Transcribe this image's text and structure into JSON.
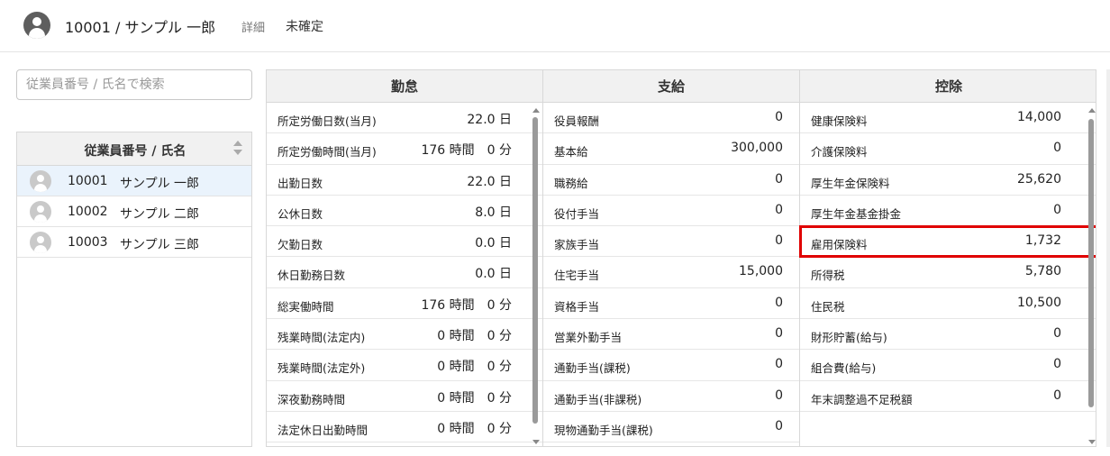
{
  "header": {
    "title": "10001 / サンプル 一郎",
    "detail_link": "詳細",
    "status": "未確定"
  },
  "search": {
    "placeholder": "従業員番号 / 氏名で検索"
  },
  "employee_list": {
    "header": "従業員番号 / 氏名",
    "items": [
      {
        "id": "10001",
        "name": "サンプル 一郎",
        "selected": true
      },
      {
        "id": "10002",
        "name": "サンプル 二郎",
        "selected": false
      },
      {
        "id": "10003",
        "name": "サンプル 三郎",
        "selected": false
      }
    ]
  },
  "kintai": {
    "header": "勤怠",
    "rows": [
      {
        "label": "所定労働日数(当月)",
        "value": "22.0 日"
      },
      {
        "label": "所定労働時間(当月)",
        "value": "176 時間　0 分"
      },
      {
        "label": "出勤日数",
        "value": "22.0 日"
      },
      {
        "label": "公休日数",
        "value": "8.0 日"
      },
      {
        "label": "欠勤日数",
        "value": "0.0 日"
      },
      {
        "label": "休日勤務日数",
        "value": "0.0 日"
      },
      {
        "label": "総実働時間",
        "value": "176 時間　0 分"
      },
      {
        "label": "残業時間(法定内)",
        "value": "0 時間　0 分"
      },
      {
        "label": "残業時間(法定外)",
        "value": "0 時間　0 分"
      },
      {
        "label": "深夜勤務時間",
        "value": "0 時間　0 分"
      },
      {
        "label": "法定休日出勤時間",
        "value": "0 時間　0 分"
      }
    ]
  },
  "shikyu": {
    "header": "支給",
    "rows": [
      {
        "label": "役員報酬",
        "value": "0"
      },
      {
        "label": "基本給",
        "value": "300,000"
      },
      {
        "label": "職務給",
        "value": "0"
      },
      {
        "label": "役付手当",
        "value": "0"
      },
      {
        "label": "家族手当",
        "value": "0"
      },
      {
        "label": "住宅手当",
        "value": "15,000"
      },
      {
        "label": "資格手当",
        "value": "0"
      },
      {
        "label": "営業外勤手当",
        "value": "0"
      },
      {
        "label": "通勤手当(課税)",
        "value": "0"
      },
      {
        "label": "通勤手当(非課税)",
        "value": "0"
      },
      {
        "label": "現物通勤手当(課税)",
        "value": "0"
      }
    ]
  },
  "kojo": {
    "header": "控除",
    "rows": [
      {
        "label": "健康保険料",
        "value": "14,000"
      },
      {
        "label": "介護保険料",
        "value": "0"
      },
      {
        "label": "厚生年金保険料",
        "value": "25,620"
      },
      {
        "label": "厚生年金基金掛金",
        "value": "0"
      },
      {
        "label": "雇用保険料",
        "value": "1,732"
      },
      {
        "label": "所得税",
        "value": "5,780"
      },
      {
        "label": "住民税",
        "value": "10,500"
      },
      {
        "label": "財形貯蓄(給与)",
        "value": "0"
      },
      {
        "label": "組合費(給与)",
        "value": "0"
      },
      {
        "label": "年末調整過不足税額",
        "value": "0"
      }
    ]
  },
  "colors": {
    "highlight": "#e00000",
    "selected_row": "#eaf3fc",
    "header_bg": "#f1f1f1"
  }
}
